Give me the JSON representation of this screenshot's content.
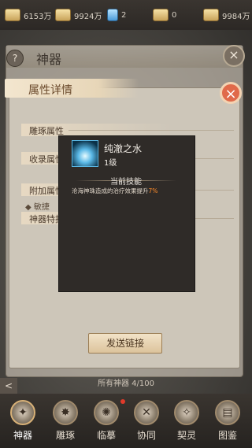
{
  "resources": [
    {
      "icon": "ingot-icon",
      "value": "6153万"
    },
    {
      "icon": "ingot-icon",
      "value": "9924万"
    },
    {
      "icon": "crystal-icon",
      "value": "2"
    },
    {
      "icon": "ingot-icon",
      "value": "0"
    },
    {
      "icon": "ingot-icon",
      "value": "9984万"
    }
  ],
  "back_panel": {
    "title": "神器",
    "help": "?",
    "close": "×"
  },
  "detail": {
    "title": "属性详情",
    "close": "×",
    "sections": [
      "雕琢属性",
      "收录属性",
      "附加属性",
      "神器特技"
    ],
    "bullet": "敏捷",
    "send_button": "发送链接"
  },
  "popup": {
    "name": "纯澈之水",
    "level": "1级",
    "current_skill": "当前技能",
    "desc_prefix": "沧海神珠造成的治疗效果提升",
    "desc_value": "7%"
  },
  "list": {
    "label": "所有神器  4/100",
    "left_arrow": "<"
  },
  "nav": [
    {
      "label": "神器",
      "glyph": "✦",
      "active": true
    },
    {
      "label": "雕琢",
      "glyph": "✸",
      "active": false
    },
    {
      "label": "临摹",
      "glyph": "✺",
      "active": false
    },
    {
      "label": "协同",
      "glyph": "✕",
      "active": false
    },
    {
      "label": "契灵",
      "glyph": "✧",
      "active": false
    },
    {
      "label": "图鉴",
      "glyph": "▤",
      "active": false
    }
  ]
}
